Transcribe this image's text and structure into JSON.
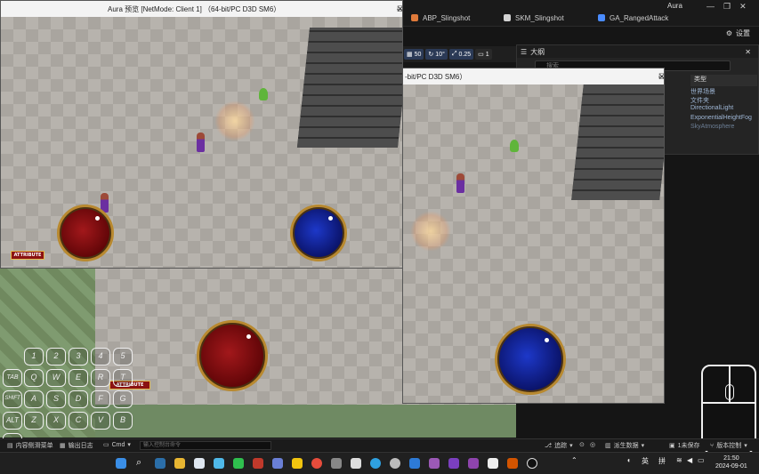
{
  "editor": {
    "app_title": "Aura",
    "tabs": [
      {
        "label": "ABP_Slingshot",
        "color": "#e07a3a"
      },
      {
        "label": "SKM_Slingshot",
        "color": "#d3d3d3"
      },
      {
        "label": "GA_RangedAttack",
        "color": "#4a8cff"
      }
    ],
    "settings_label": "设置",
    "window_controls": [
      "—",
      "❐",
      "✕"
    ]
  },
  "viewport_toolbar": {
    "grid": "50",
    "angle": "10°",
    "scale": "0.25",
    "camera": "1"
  },
  "outliner": {
    "title": "大纲",
    "search_placeholder": "搜索",
    "type_header": "类型",
    "rows": [
      "世界场景",
      "文件夹",
      "DirectionalLight",
      "ExponentialHeightFog",
      "SkyAtmosphere"
    ]
  },
  "client_window": {
    "title": "Aura 预览 [NetMode: Client 1]  （64-bit/PC D3D SM6）",
    "attribute_label": "ATTRIBUTE",
    "controls": [
      "—",
      "☐",
      "✕"
    ]
  },
  "second_window": {
    "title": "-bit/PC D3D SM6）",
    "controls": [
      "—",
      "☐",
      "✕"
    ]
  },
  "main_viewport": {
    "attribute_label": "ATTRIBUTE"
  },
  "keyboard_overlay": {
    "keys": [
      "1",
      "2",
      "3",
      "4",
      "5",
      "TAB",
      "Q",
      "W",
      "E",
      "R",
      "T",
      "SHIFT",
      "A",
      "S",
      "D",
      "F",
      "G",
      "ALT",
      "Z",
      "X",
      "C",
      "V",
      "B",
      "CTRL"
    ]
  },
  "statusbar": {
    "content_drawer": "内容侧滑菜单",
    "output_log": "输出日志",
    "cmd": "Cmd",
    "cmd_placeholder": "输入控制台命令",
    "trace": "追踪",
    "derived_data": "派生数据",
    "unsaved": "1未保存",
    "source_control": "版本控制"
  },
  "taskbar": {
    "lang1": "英",
    "lang2": "拼",
    "time": "21:50",
    "date": "2024-09-01"
  }
}
